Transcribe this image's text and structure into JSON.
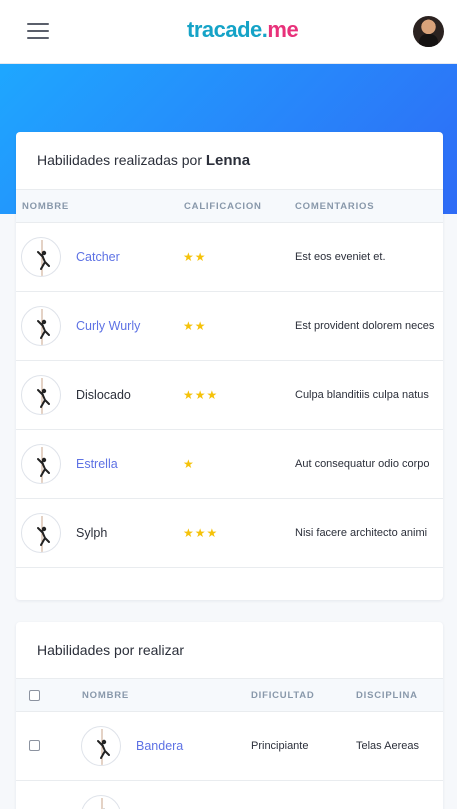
{
  "navbar": {
    "logo_part1": "tracade.",
    "logo_part2": "me"
  },
  "done_skills": {
    "title_prefix": "Habilidades realizadas por",
    "title_user": "Lenna",
    "columns": [
      "NOMBRE",
      "CALIFICACION",
      "COMENTARIOS"
    ],
    "rows": [
      {
        "name": "Catcher",
        "rating": 2,
        "stars": "★★",
        "comment": "Est eos eveniet et.",
        "linked": true
      },
      {
        "name": "Curly Wurly",
        "rating": 2,
        "stars": "★★",
        "comment": "Est provident dolorem neces",
        "linked": true
      },
      {
        "name": "Dislocado",
        "rating": 3,
        "stars": "★★★",
        "comment": "Culpa blanditiis culpa natus",
        "linked": false
      },
      {
        "name": "Estrella",
        "rating": 1,
        "stars": "★",
        "comment": "Aut consequatur odio corpo",
        "linked": true
      },
      {
        "name": "Sylph",
        "rating": 3,
        "stars": "★★★",
        "comment": "Nisi facere architecto animi",
        "linked": false
      }
    ]
  },
  "pending_skills": {
    "title": "Habilidades por realizar",
    "columns": [
      "NOMBRE",
      "DIFICULTAD",
      "DISCIPLINA"
    ],
    "rows": [
      {
        "name": "Bandera",
        "difficulty": "Principiante",
        "discipline": "Telas Aereas"
      }
    ]
  },
  "colors": {
    "accent": "#5e72e4",
    "star": "#f5c20a",
    "hero_start": "#1ea7ff",
    "hero_end": "#2f6bf6",
    "logo_teal": "#15a3c7",
    "logo_pink": "#e8317a"
  }
}
